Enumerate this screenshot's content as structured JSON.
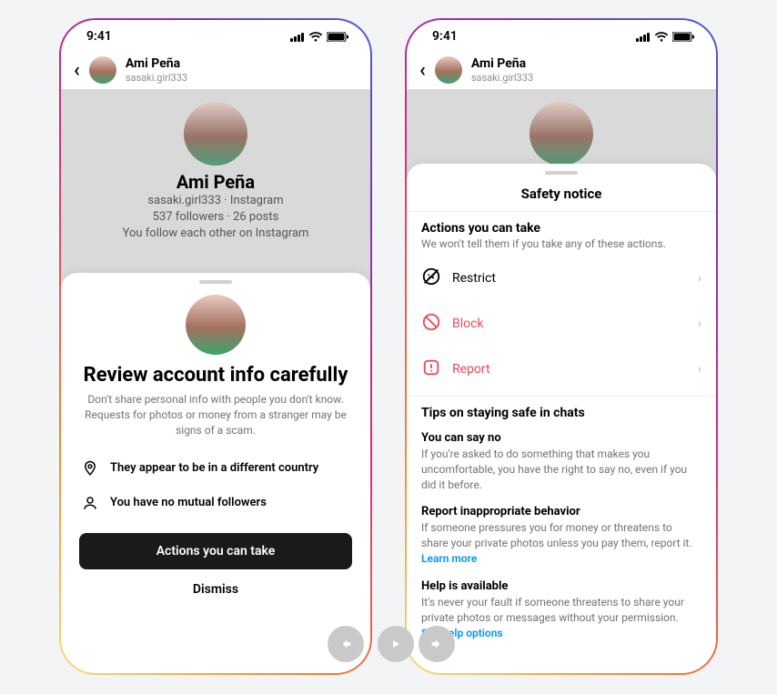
{
  "status": {
    "time": "9:41"
  },
  "header": {
    "name": "Ami Peña",
    "handle": "sasaki.girl333"
  },
  "profile": {
    "name": "Ami Peña",
    "line1": "sasaki.girl333 · Instagram",
    "line2": "537 followers · 26 posts",
    "line3": "You follow each other on Instagram"
  },
  "review_sheet": {
    "title": "Review account info carefully",
    "subtitle": "Don't share personal info with people you don't know. Requests for photos or money from a stranger may be signs of a scam.",
    "signal_country": "They appear to be in a different country",
    "signal_mutuals": "You have no mutual followers",
    "primary_btn": "Actions you can take",
    "dismiss_btn": "Dismiss"
  },
  "safety_sheet": {
    "title": "Safety notice",
    "actions_head": "Actions you can take",
    "actions_sub": "We won't tell them if you take any of these actions.",
    "restrict": "Restrict",
    "block": "Block",
    "report": "Report",
    "tips_head": "Tips on staying safe in chats",
    "tip1_head": "You can say no",
    "tip1_body": "If you're asked to do something that makes you uncomfortable, you have the right to say no, even if you did it before.",
    "tip2_head": "Report inappropriate behavior",
    "tip2_body": "If someone pressures you for money or threatens to share your private photos unless you pay them, report it.",
    "tip2_link": "Learn more",
    "tip3_head": "Help is available",
    "tip3_body": "It's never your fault if someone threatens to share your private photos or messages without your permission.",
    "tip3_link": "See help options"
  }
}
